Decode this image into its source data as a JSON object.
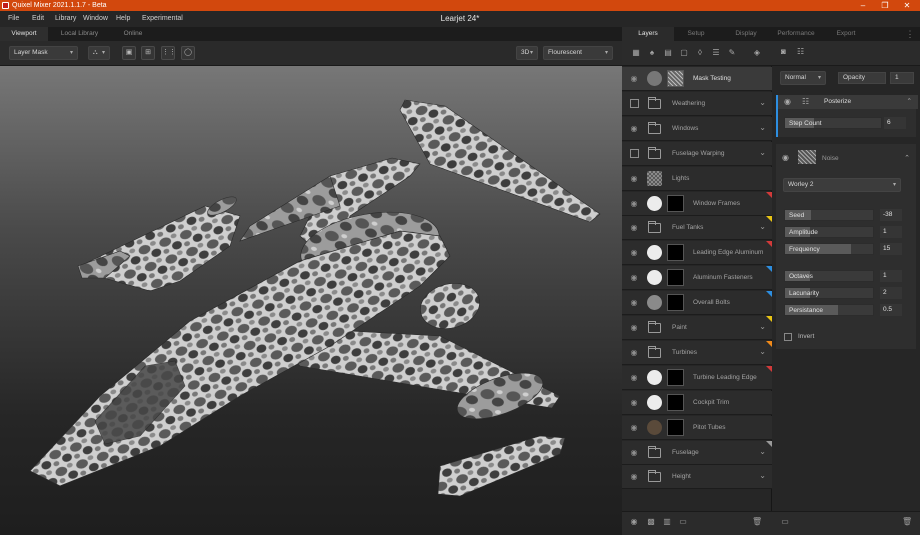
{
  "app": {
    "title": "Quixel Mixer 2021.1.1.7 - Beta",
    "document_title": "Learjet 24*"
  },
  "menu": [
    "File",
    "Edit",
    "Library",
    "Window",
    "Help",
    "Experimental"
  ],
  "window_controls": {
    "minimize": "–",
    "restore": "❐",
    "close": "✕"
  },
  "left_tabs": [
    "Viewport",
    "Local Library",
    "Online"
  ],
  "viewport_toolbar": {
    "mode_select": "Layer Mask",
    "view_mode": "3D",
    "lighting": "Flourescent"
  },
  "right_tabs": [
    "Layers",
    "Setup",
    "Display",
    "Performance",
    "Export"
  ],
  "layers": [
    {
      "name": "Mask Testing",
      "kind": "material",
      "control": "eye",
      "selected": true
    },
    {
      "name": "Weathering",
      "kind": "folder",
      "control": "checkbox",
      "expand": true
    },
    {
      "name": "Windows",
      "kind": "folder",
      "control": "eye",
      "expand": true
    },
    {
      "name": "Fuselage Warping",
      "kind": "folder",
      "control": "checkbox",
      "expand": true
    },
    {
      "name": "Lights",
      "kind": "pattern",
      "control": "eye"
    },
    {
      "name": "Window Frames",
      "kind": "masked",
      "control": "eye",
      "tag": "#d23a3a"
    },
    {
      "name": "Fuel Tanks",
      "kind": "folder",
      "control": "eye",
      "expand": true,
      "tag": "#e8c414"
    },
    {
      "name": "Leading Edge Aluminum",
      "kind": "masked",
      "control": "eye",
      "tag": "#d23a3a"
    },
    {
      "name": "Aluminum Fasteners",
      "kind": "masked",
      "control": "eye",
      "tag": "#2d8ee0"
    },
    {
      "name": "Overall Bolts",
      "kind": "masked-gray",
      "control": "eye",
      "tag": "#2d8ee0"
    },
    {
      "name": "Paint",
      "kind": "folder",
      "control": "eye",
      "expand": true,
      "tag": "#e8c414"
    },
    {
      "name": "Turbines",
      "kind": "folder",
      "control": "eye",
      "expand": true,
      "tag": "#f08a1a"
    },
    {
      "name": "Turbine Leading Edge",
      "kind": "masked",
      "control": "eye",
      "tag": "#d23a3a"
    },
    {
      "name": "Cockpit Trim",
      "kind": "masked",
      "control": "eye"
    },
    {
      "name": "Pitot Tubes",
      "kind": "masked-brown",
      "control": "eye"
    },
    {
      "name": "Fuselage",
      "kind": "folder",
      "control": "eye",
      "expand": true,
      "tag": "#9a9a9a"
    },
    {
      "name": "Height",
      "kind": "folder",
      "control": "eye",
      "expand": true
    }
  ],
  "properties": {
    "blend_mode": "Normal",
    "opacity_label": "Opacity",
    "opacity_value": "1",
    "posterize": {
      "title": "Posterize",
      "step_count_label": "Step Count",
      "step_count": "6",
      "step_fill": 0.3
    },
    "noise": {
      "title": "Noise",
      "type": "Worley 2",
      "params": [
        {
          "label": "Seed",
          "value": "-38",
          "fill": 0.3
        },
        {
          "label": "Amplitude",
          "value": "1",
          "fill": 0.0
        },
        {
          "label": "Frequency",
          "value": "15",
          "fill": 0.75
        },
        {
          "label": "Octaves",
          "value": "1",
          "fill": 0.0
        },
        {
          "label": "Lacunarity",
          "value": "2",
          "fill": 0.0
        },
        {
          "label": "Persistance",
          "value": "0.5",
          "fill": 0.6
        }
      ],
      "invert_label": "Invert"
    }
  }
}
